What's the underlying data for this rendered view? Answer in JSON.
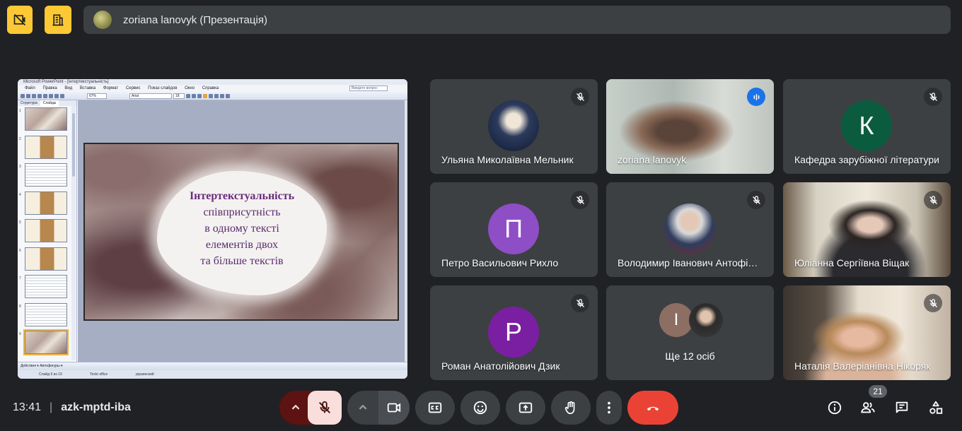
{
  "presenter": {
    "label": "zoriana lanovyk (Презентація)"
  },
  "powerpoint": {
    "window_title": "Microsoft PowerPoint - [Інтертекстуальність]",
    "menu": [
      "Файл",
      "Правка",
      "Вид",
      "Вставка",
      "Формат",
      "Сервис",
      "Показ слайдов",
      "Окно",
      "Справка"
    ],
    "search_placeholder": "Введите вопрос",
    "zoom": "67%",
    "font_name": "Arial",
    "font_size": "18",
    "left_tabs": [
      "Структура",
      "Слайды"
    ],
    "thumb_numbers": [
      "1",
      "2",
      "3",
      "4",
      "5",
      "6",
      "7",
      "8",
      "9"
    ],
    "bottom_toolbar": "Действия ▾   Автофигуры ▾",
    "status": [
      "Слайд 9 из 19",
      "Texto office",
      "украинский"
    ],
    "slide": {
      "title": "Інтертекстуальність",
      "lines": [
        "співприсутність",
        "в одному тексті",
        "елементів двох",
        "та більше текстів"
      ]
    }
  },
  "participants": [
    {
      "name": "Ульяна Миколаївна Мельник",
      "muted": true
    },
    {
      "name": "zoriana lanovyk",
      "speaking": true
    },
    {
      "name": "Кафедра зарубіжної літератури",
      "initial": "К",
      "avatar_color": "#0b5c3e",
      "muted": true
    },
    {
      "name": "Петро Васильович Рихло",
      "initial": "П",
      "avatar_color": "#8e4ec6",
      "muted": true
    },
    {
      "name": "Володимир Іванович Антофійчук",
      "muted": true
    },
    {
      "name": "Юліанна Сергіївна Віщак",
      "muted": true
    },
    {
      "name": "Роман Анатолійович Дзик",
      "initial": "P",
      "avatar_color": "#7b1fa2",
      "muted": true
    },
    {
      "more_initial": "І",
      "label": "Ще 12 осіб"
    },
    {
      "name": "Наталія Валеріанівна Нікоряк",
      "muted": true
    }
  ],
  "meeting": {
    "time": "13:41",
    "code": "azk-mptd-iba"
  },
  "participant_count": "21",
  "colors": {
    "background": "#202124",
    "tile": "#3c4043",
    "accent_yellow": "#fcc934",
    "end_call": "#ea4335",
    "mic_off": "#f9dedc",
    "speaking": "#8ab4f8"
  }
}
